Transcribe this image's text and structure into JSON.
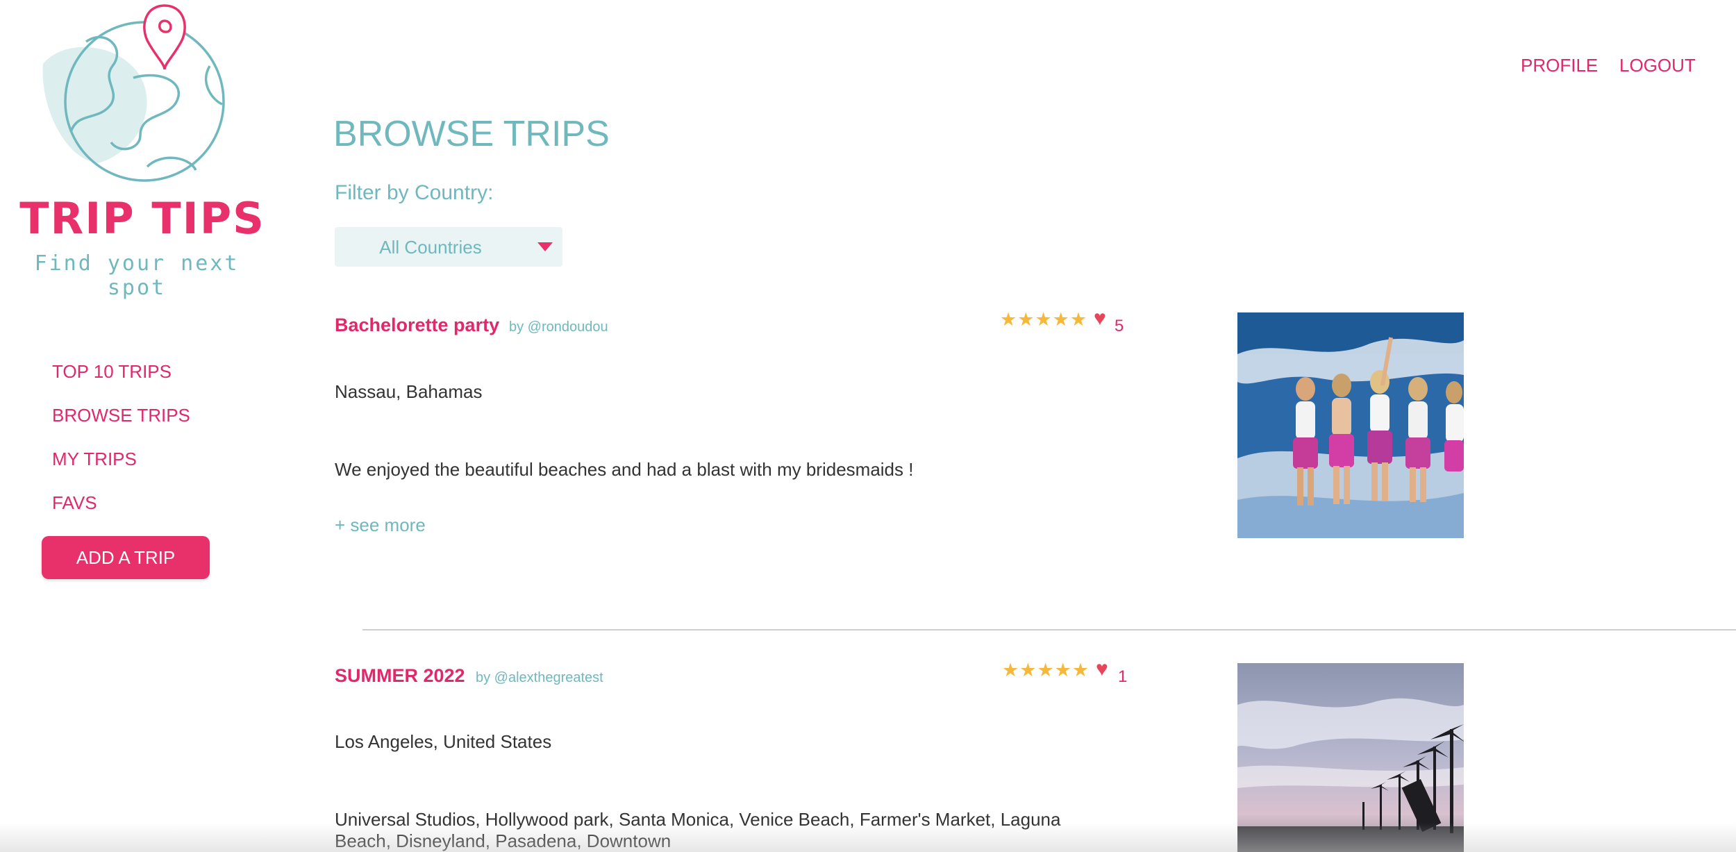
{
  "brand": {
    "title": "TRIP TIPS",
    "tagline": "Find your next spot"
  },
  "header": {
    "profile": "PROFILE",
    "logout": "LOGOUT"
  },
  "sidebar": {
    "items": [
      {
        "label": "TOP 10 TRIPS"
      },
      {
        "label": "BROWSE TRIPS"
      },
      {
        "label": "MY TRIPS"
      },
      {
        "label": "FAVS"
      }
    ],
    "add_trip": "ADD A TRIP"
  },
  "main": {
    "title": "BROWSE TRIPS",
    "filter_label": "Filter by Country:",
    "country_select": "All Countries"
  },
  "trips": [
    {
      "title": "Bachelorette party",
      "author": "by @rondoudou",
      "rating": 5,
      "likes": "5",
      "location": "Nassau, Bahamas",
      "description": "We enjoyed the beautiful beaches and had a blast with my bridesmaids !",
      "see_more": "+ see more"
    },
    {
      "title": "SUMMER 2022",
      "author": "by @alexthegreatest",
      "rating": 5,
      "likes": "1",
      "location": "Los Angeles, United States",
      "description": "Universal Studios, Hollywood park, Santa Monica, Venice Beach, Farmer's Market, Laguna Beach, Disneyland, Pasadena, Downtown"
    }
  ],
  "colors": {
    "accent": "#e8316a",
    "teal": "#6fb8bd",
    "star": "#f5b83a"
  }
}
